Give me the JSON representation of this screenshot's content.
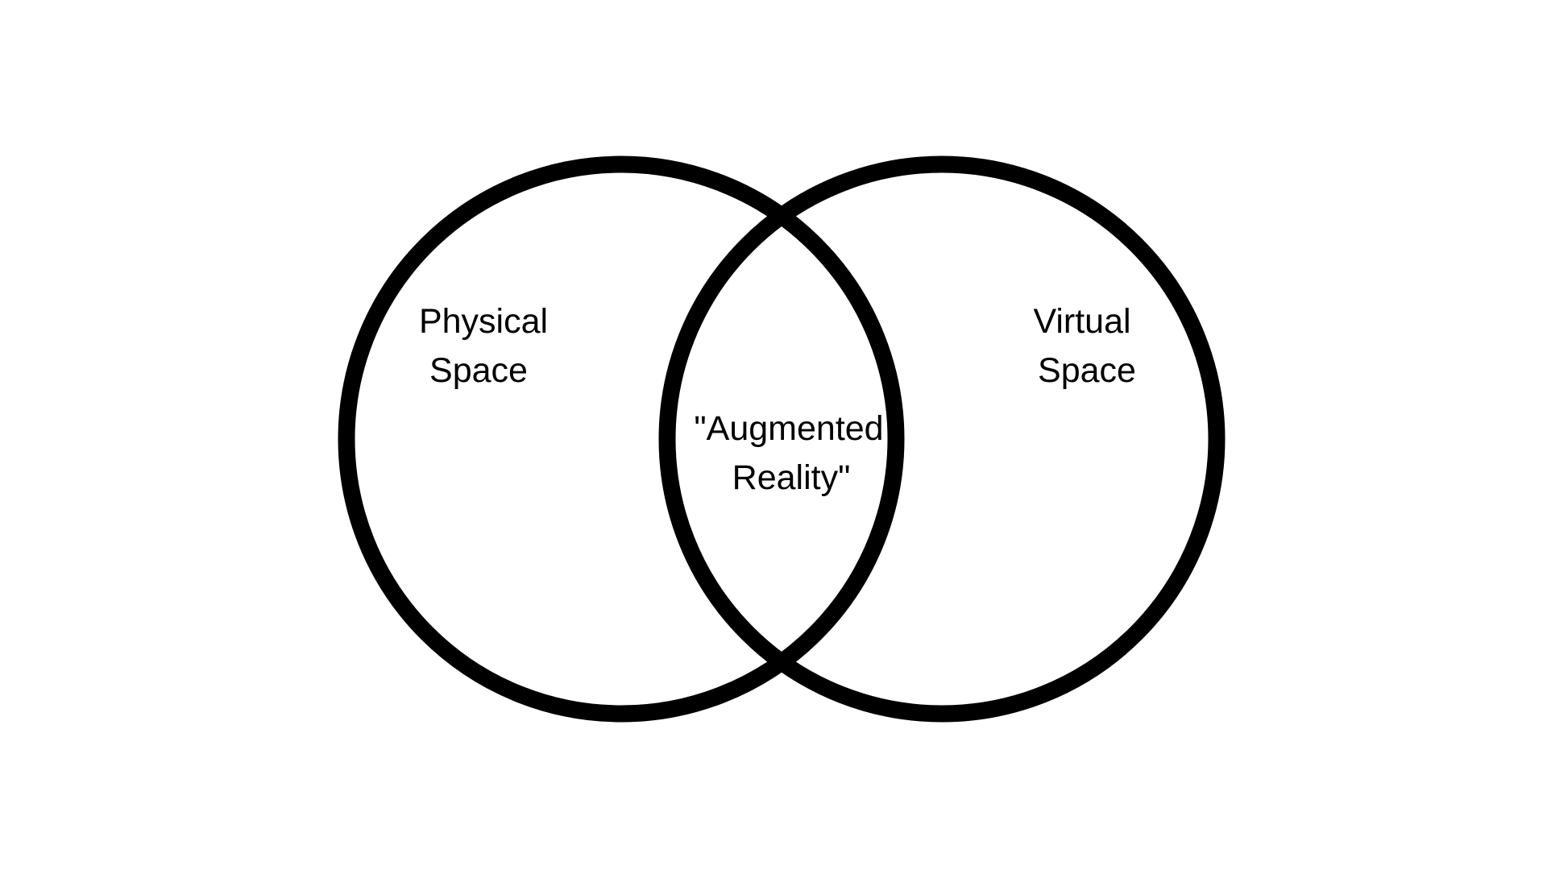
{
  "diagram": {
    "type": "venn",
    "sets": [
      {
        "label_lines": [
          "Physical",
          "Space"
        ]
      },
      {
        "label_lines": [
          "Virtual",
          "Space"
        ]
      }
    ],
    "intersection": {
      "label_lines": [
        "\"Augmented",
        "Reality\""
      ]
    },
    "colors": {
      "outline": "#000000",
      "background": "#ffffff",
      "text": "#000000"
    }
  }
}
